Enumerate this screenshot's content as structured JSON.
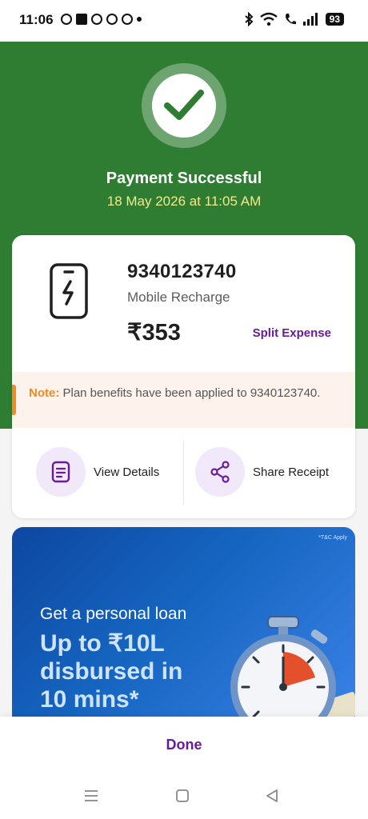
{
  "status_bar": {
    "time": "11:06",
    "battery": "93"
  },
  "payment": {
    "title": "Payment Successful",
    "datetime": "18 May 2026 at 11:05 AM"
  },
  "recharge": {
    "number": "9340123740",
    "category": "Mobile Recharge",
    "amount": "₹353",
    "split_label": "Split Expense"
  },
  "note": {
    "label": "Note:",
    "text": " Plan benefits have been applied to 9340123740."
  },
  "actions": {
    "view_details": "View Details",
    "share_receipt": "Share Receipt"
  },
  "banner": {
    "tnc": "*T&C Apply",
    "subtitle": "Get a personal loan",
    "headline_line1": "Up to ₹10L",
    "headline_line2": "disbursed in",
    "headline_line3": "10 mins*"
  },
  "footer": {
    "done_label": "Done"
  },
  "colors": {
    "success_green": "#2e7d32",
    "brand_purple": "#6a1b9a",
    "note_orange": "#f08a24",
    "date_yellow": "#f2ea8c"
  },
  "icons": [
    "whatsapp-icon",
    "flipboard-icon",
    "messenger-icon",
    "chat-icon",
    "bluetooth-icon",
    "wifi-icon",
    "wifi-call-icon",
    "signal-icon",
    "check-icon",
    "mobile-recharge-icon",
    "document-icon",
    "share-icon",
    "stopwatch-icon",
    "menu-nav-icon",
    "home-nav-icon",
    "back-nav-icon"
  ]
}
